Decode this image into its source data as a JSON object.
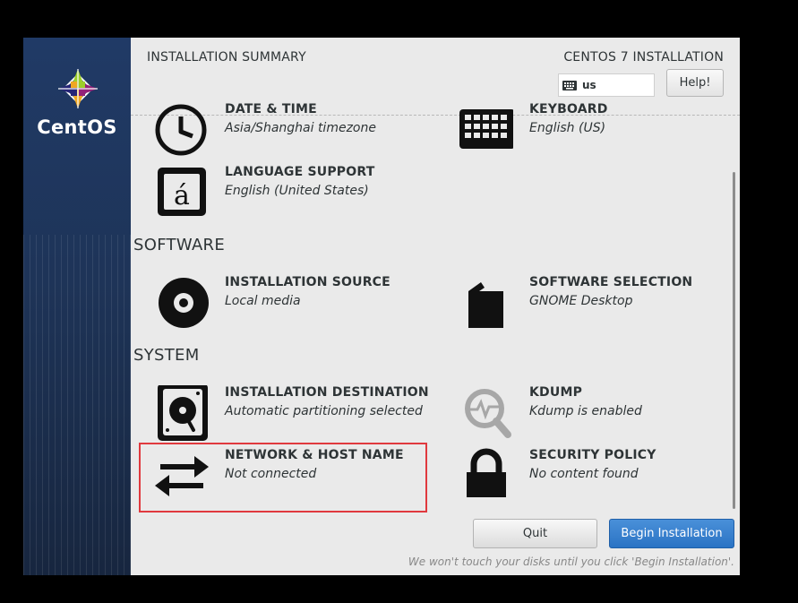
{
  "brand": "CentOS",
  "header": {
    "title": "INSTALLATION SUMMARY",
    "product": "CENTOS 7 INSTALLATION",
    "keyboard_layout": "us",
    "help_label": "Help!"
  },
  "localization": [
    {
      "title": "DATE & TIME",
      "status": "Asia/Shanghai timezone",
      "icon": "clock-icon"
    },
    {
      "title": "KEYBOARD",
      "status": "English (US)",
      "icon": "keyboard-icon"
    },
    {
      "title": "LANGUAGE SUPPORT",
      "status": "English (United States)",
      "icon": "language-icon"
    }
  ],
  "software": {
    "heading": "SOFTWARE",
    "items": [
      {
        "title": "INSTALLATION SOURCE",
        "status": "Local media",
        "icon": "disc-icon"
      },
      {
        "title": "SOFTWARE SELECTION",
        "status": "GNOME Desktop",
        "icon": "package-icon"
      }
    ]
  },
  "system": {
    "heading": "SYSTEM",
    "items": [
      {
        "title": "INSTALLATION DESTINATION",
        "status": "Automatic partitioning selected",
        "icon": "harddisk-icon"
      },
      {
        "title": "KDUMP",
        "status": "Kdump is enabled",
        "icon": "magnifier-icon"
      },
      {
        "title": "NETWORK & HOST NAME",
        "status": "Not connected",
        "icon": "network-arrows-icon"
      },
      {
        "title": "SECURITY POLICY",
        "status": "No content found",
        "icon": "lock-icon"
      }
    ]
  },
  "footer": {
    "quit_label": "Quit",
    "begin_label": "Begin Installation",
    "note": "We won't touch your disks until you click 'Begin Installation'."
  },
  "colors": {
    "accent": "#2a73c4",
    "highlight": "#e0393e",
    "sidebar": "#1e3458"
  }
}
